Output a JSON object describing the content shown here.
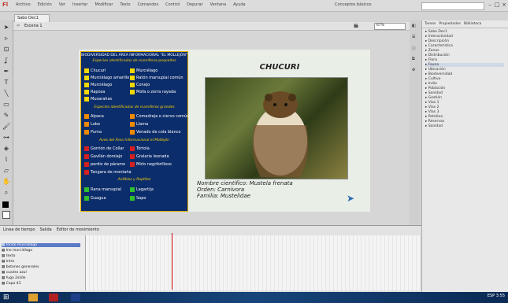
{
  "app": {
    "logo": "Fl",
    "menu": [
      "Archivo",
      "Edición",
      "Ver",
      "Insertar",
      "Modificar",
      "Texto",
      "Comandos",
      "Control",
      "Depurar",
      "Ventana",
      "Ayuda"
    ],
    "workspace": "Conceptos básicos",
    "document_tab": "Sabo Dec1"
  },
  "editbar": {
    "scene": "Escena 1",
    "zoom": "67%"
  },
  "stage": {
    "title": "CHUCURI",
    "left_header": "BIODIVERSIDAD DEL ÁREA INFORMACIONAL \"EL MOLLEJÓN\"",
    "sec1": "Especies identificadas de mamíferos pequeños",
    "sec1_items": [
      "Chucuri",
      "Murciélago amarillo",
      "Murciélago",
      "Raposa",
      "Musarañas",
      "Murciélago",
      "Ratón marsupial común",
      "Conejo",
      "Mofa o zorra rayada"
    ],
    "sec2": "Especies identificadas de mamíferos grandes",
    "sec2_items": [
      "Alpaca",
      "Lobo",
      "Puma",
      "Comadreja o ciervo común",
      "Llama",
      "Venado de cola blanco"
    ],
    "sec3": "Aves del Área Informacional el Mollejón",
    "sec3_items": [
      "Gorrión de Collar",
      "Gavilán dorsiajo",
      "perdiz de páramo",
      "Tangara de montaña",
      "Tórtola",
      "Gralaria leonada",
      "Mirlo negribrilloso"
    ],
    "sec4": "Anfibios y Reptiles",
    "sec4_items": [
      "Rana marsupial",
      "Lagartija",
      "Guagua",
      "Sapo"
    ],
    "sci": "Nombre científico: Mustela frenata",
    "order": "Orden: Carnívora",
    "family": "Familia: Mustelidae"
  },
  "panel": {
    "tabs": [
      "Tareas",
      "Propiedades",
      "Biblioteca"
    ],
    "items": [
      "Sabo Dec1",
      "Interactividad",
      "Descripción",
      "Característica",
      "Zonas",
      "Distribución",
      "Flora",
      "Fauna",
      "Ubicación",
      "Biodiversidad",
      "Cultivo",
      "Indio",
      "Población",
      "Sanidad",
      "Gestión",
      "Vías 1",
      "Vías 2",
      "Vías 3",
      "Petróleo",
      "Reservas",
      "Sanidad"
    ]
  },
  "timeline": {
    "tabs": [
      "Línea de tiempo",
      "Salida",
      "Editor de movimiento"
    ],
    "layers": [
      "fondo murciélago",
      "Ino murciélago",
      "texto",
      "Intro",
      "botones generales",
      "cuadro azul",
      "fuga 2slide",
      "Capa 43"
    ]
  },
  "clock": "ESP 3:55"
}
